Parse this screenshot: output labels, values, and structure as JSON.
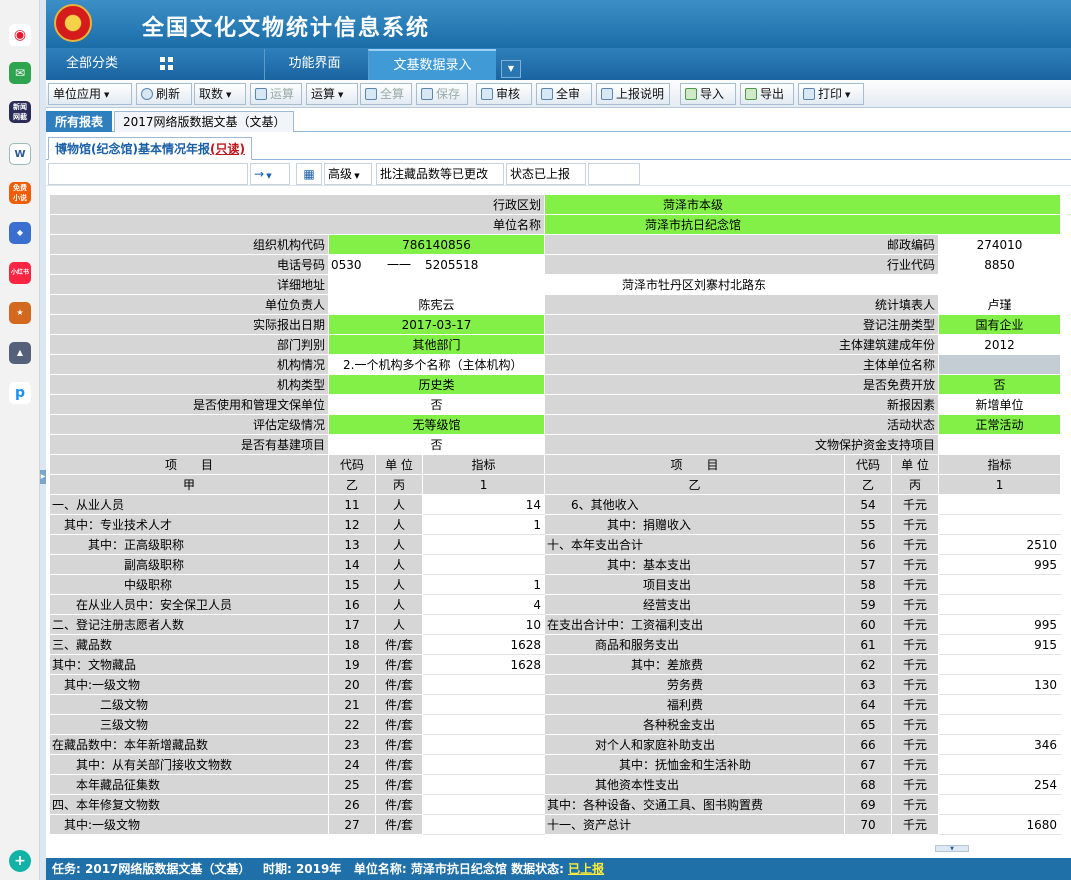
{
  "app": {
    "title": "全国文化文物统计信息系统"
  },
  "sidebar": {
    "icons": [
      "weibo-icon",
      "mail-icon",
      "news-icon",
      "word-icon",
      "novel-app-icon",
      "game-app-icon",
      "xiaohongshu-icon",
      "game-app-icon-2",
      "game-app-icon-3",
      "p-app-icon",
      "plus-app-icon"
    ],
    "labels": {
      "news": "新闻\n网截",
      "novel": "免费\n小说",
      "xhs": "小红书"
    }
  },
  "nav": {
    "all_category": "全部分类",
    "function_ui": "功能界面",
    "data_entry": "文基数据录入"
  },
  "toolbar": {
    "unit_app": "单位应用",
    "refresh": "刷新",
    "fetch": "取数",
    "compute_dis": "运算",
    "compute": "运算",
    "all_calc": "全算",
    "save": "保存",
    "review": "审核",
    "all_review": "全审",
    "report_note": "上报说明",
    "import": "导入",
    "export": "导出",
    "print": "打印"
  },
  "report_tabs": {
    "all": "所有报表",
    "t2017": "2017网络版数据文基（文基）"
  },
  "sub_tab": {
    "name": "博物馆(纪念馆)基本情况年报",
    "readonly": "(只读)"
  },
  "filter": {
    "advanced": "高级",
    "note_label": "批注",
    "note_value": "藏品数等已更改",
    "status_label": "状态",
    "status_value": "已上报"
  },
  "form": {
    "admin_region_label": "行政区划",
    "admin_region": "菏泽市本级",
    "unit_name_label": "单位名称",
    "unit_name": "菏泽市抗日纪念馆",
    "org_code_label": "组织机构代码",
    "org_code": "786140856",
    "postcode_label": "邮政编码",
    "postcode": "274010",
    "phone_label": "电话号码",
    "phone_area": "0530",
    "phone_sep": "一一",
    "phone_num": "5205518",
    "industry_code_label": "行业代码",
    "industry_code": "8850",
    "address_label": "详细地址",
    "address": "菏泽市牡丹区刘寨村北路东",
    "head_label": "单位负责人",
    "head": "陈宪云",
    "filler_label": "统计填表人",
    "filler": "卢瑾",
    "report_date_label": "实际报出日期",
    "report_date": "2017-03-17",
    "reg_type_label": "登记注册类型",
    "reg_type": "国有企业",
    "dept_label": "部门判别",
    "dept": "其他部门",
    "build_year_label": "主体建筑建成年份",
    "build_year": "2012",
    "inst_label": "机构情况",
    "inst": "2.一个机构多个名称（主体机构）",
    "main_unit_label": "主体单位名称",
    "main_unit": "",
    "inst_type_label": "机构类型",
    "inst_type": "历史类",
    "free_label": "是否免费开放",
    "free": "否",
    "use_relic_label": "是否使用和管理文保单位",
    "use_relic": "否",
    "new_factor_label": "新报因素",
    "new_factor": "新增单位",
    "rating_label": "评估定级情况",
    "rating": "无等级馆",
    "activity_label": "活动状态",
    "activity": "正常活动",
    "capital_label": "是否有基建项目",
    "capital": "否",
    "fund_label": "文物保护资金支持项目",
    "fund": ""
  },
  "indicator_header": {
    "item": "项　　目",
    "code": "代码",
    "unit": "单 位",
    "value": "指标",
    "jia": "甲",
    "yi": "乙",
    "bing": "丙",
    "one": "1"
  },
  "left_rows": [
    {
      "item": "一、从业人员",
      "code": "11",
      "unit": "人",
      "value": "14"
    },
    {
      "item": "　其中：专业技术人才",
      "code": "12",
      "unit": "人",
      "value": "1"
    },
    {
      "item": "　　　其中：正高级职称",
      "code": "13",
      "unit": "人",
      "value": ""
    },
    {
      "item": "　　　　　　副高级职称",
      "code": "14",
      "unit": "人",
      "value": ""
    },
    {
      "item": "　　　　　　中级职称",
      "code": "15",
      "unit": "人",
      "value": "1"
    },
    {
      "item": "　　在从业人员中：安全保卫人员",
      "code": "16",
      "unit": "人",
      "value": "4"
    },
    {
      "item": "二、登记注册志愿者人数",
      "code": "17",
      "unit": "人",
      "value": "10"
    },
    {
      "item": "三、藏品数",
      "code": "18",
      "unit": "件/套",
      "value": "1628"
    },
    {
      "item": "其中：文物藏品",
      "code": "19",
      "unit": "件/套",
      "value": "1628"
    },
    {
      "item": "　其中:一级文物",
      "code": "20",
      "unit": "件/套",
      "value": ""
    },
    {
      "item": "　　　　二级文物",
      "code": "21",
      "unit": "件/套",
      "value": ""
    },
    {
      "item": "　　　　三级文物",
      "code": "22",
      "unit": "件/套",
      "value": ""
    },
    {
      "item": "在藏品数中：本年新增藏品数",
      "code": "23",
      "unit": "件/套",
      "value": ""
    },
    {
      "item": "　　其中：从有关部门接收文物数",
      "code": "24",
      "unit": "件/套",
      "value": ""
    },
    {
      "item": "　　本年藏品征集数",
      "code": "25",
      "unit": "件/套",
      "value": ""
    },
    {
      "item": "四、本年修复文物数",
      "code": "26",
      "unit": "件/套",
      "value": ""
    },
    {
      "item": "　其中:一级文物",
      "code": "27",
      "unit": "件/套",
      "value": ""
    }
  ],
  "right_rows": [
    {
      "item": "　　6、其他收入",
      "code": "54",
      "unit": "千元",
      "value": ""
    },
    {
      "item": "　　　　　其中：捐赠收入",
      "code": "55",
      "unit": "千元",
      "value": ""
    },
    {
      "item": "十、本年支出合计",
      "code": "56",
      "unit": "千元",
      "value": "2510"
    },
    {
      "item": "　　　　　其中：基本支出",
      "code": "57",
      "unit": "千元",
      "value": "995"
    },
    {
      "item": "　　　　　　　　项目支出",
      "code": "58",
      "unit": "千元",
      "value": ""
    },
    {
      "item": "　　　　　　　　经营支出",
      "code": "59",
      "unit": "千元",
      "value": ""
    },
    {
      "item": "在支出合计中：工资福利支出",
      "code": "60",
      "unit": "千元",
      "value": "995"
    },
    {
      "item": "　　　　商品和服务支出",
      "code": "61",
      "unit": "千元",
      "value": "915"
    },
    {
      "item": "　　　　　　　其中：差旅费",
      "code": "62",
      "unit": "千元",
      "value": ""
    },
    {
      "item": "　　　　　　　　　　劳务费",
      "code": "63",
      "unit": "千元",
      "value": "130"
    },
    {
      "item": "　　　　　　　　　　福利费",
      "code": "64",
      "unit": "千元",
      "value": ""
    },
    {
      "item": "　　　　　　　　各种税金支出",
      "code": "65",
      "unit": "千元",
      "value": ""
    },
    {
      "item": "　　　　对个人和家庭补助支出",
      "code": "66",
      "unit": "千元",
      "value": "346"
    },
    {
      "item": "　　　　　　其中：抚恤金和生活补助",
      "code": "67",
      "unit": "千元",
      "value": ""
    },
    {
      "item": "　　　　其他资本性支出",
      "code": "68",
      "unit": "千元",
      "value": "254"
    },
    {
      "item": "其中：各种设备、交通工具、图书购置费",
      "code": "69",
      "unit": "千元",
      "value": ""
    },
    {
      "item": "十一、资产总计",
      "code": "70",
      "unit": "千元",
      "value": "1680"
    }
  ],
  "status_bar": {
    "task_label": "任务:",
    "task": "2017网络版数据文基（文基）",
    "period_label": "时期:",
    "period": "2019年",
    "unit_label": "单位名称:",
    "unit": "菏泽市抗日纪念馆",
    "state_label": "数据状态:",
    "state": "已上报"
  },
  "colors": {
    "header": "#1b6da8",
    "green_cell": "#82f046",
    "label_gray": "#d6d6d6",
    "status_bar": "#1f6fa8"
  }
}
